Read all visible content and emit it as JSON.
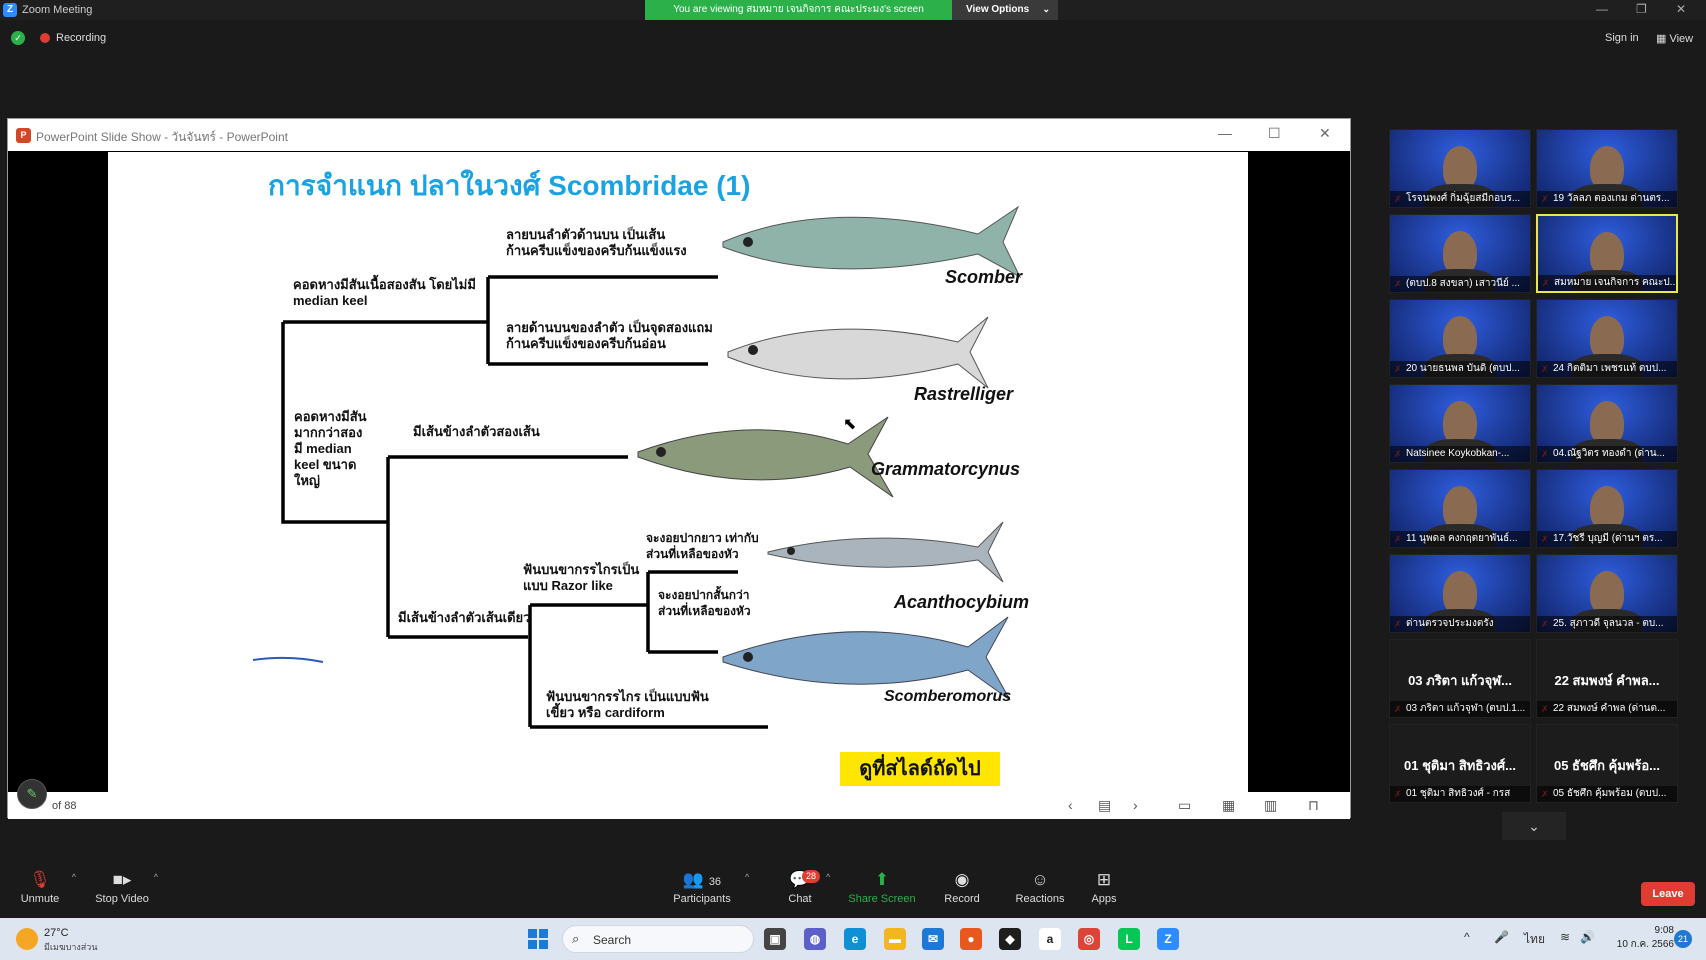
{
  "window": {
    "title": "Zoom Meeting",
    "viewing_banner": "You are viewing สมหมาย เจนกิจการ คณะประมง's screen",
    "view_options": "View Options",
    "recording": "Recording",
    "sign_in": "Sign in",
    "view": "View"
  },
  "powerpoint": {
    "title": "PowerPoint Slide Show - วันจันทร์ - PowerPoint",
    "slide_counter": "of 88"
  },
  "slide": {
    "title": "การจำแนก ปลาในวงศ์ Scombridae (1)",
    "labels": {
      "scomber_desc": "ลายบนลำตัวด้านบน เป็นเส้น\nก้านครีบแข็งของครีบก้นแข็งแรง",
      "rastrelliger_desc": "ลายด้านบนของลำตัว เป็นจุดสองแถม\nก้านครีบแข็งของครีบก้นอ่อน",
      "keel_small": "คอดหางมีสันเนื้อสองสัน โดยไม่มี\nmedian keel",
      "keel_large": "คอดหางมีสัน\nมากกว่าสอง\nมี median\nkeel ขนาด\nใหญ่",
      "two_lateral": "มีเส้นข้างลำตัวสองเส้น",
      "one_lateral": "มีเส้นข้างลำตัวเส้นเดียว",
      "razor_teeth": "ฟันบนขากรรไกรเป็น\nแบบ Razor like",
      "long_beak": "จะงอยปากยาว เท่ากับ\nส่วนที่เหลือของหัว",
      "short_beak": "จะงอยปากสั้นกว่า\nส่วนที่เหลือของหัว",
      "cardiform": "ฟันบนขากรรไกร เป็นแบบฟัน\nเขี้ยว หรือ cardiform"
    },
    "genera": {
      "scomber": "Scomber",
      "rastrelliger": "Rastrelliger",
      "grammatorcynus": "Grammatorcynus",
      "acanthocybium": "Acanthocybium",
      "scomberomorus": "Scomberomorus"
    },
    "next_button": "ดูที่สไลด์ถัดไป"
  },
  "participants": [
    {
      "name": "โรจนพงศ์ กิ่มฉุ้ยสมีกอบร...",
      "video": true
    },
    {
      "name": "19 วัลลภ ตองเกม ด่านตร...",
      "video": true
    },
    {
      "name": "(ตบป.8 สงขลา) เสาวนีย์ ...",
      "video": true
    },
    {
      "name": "สมหมาย เจนกิจการ คณะป...",
      "video": true,
      "active": true
    },
    {
      "name": "20 นายธนพล บันดิ (ตบป...",
      "video": true
    },
    {
      "name": "24 กิตติมา เพชรแท้ ตบป...",
      "video": true
    },
    {
      "name": "Natsinee Koykobkan-...",
      "video": true
    },
    {
      "name": "04.ณัฐวิตร ทองดำ (ด่าน...",
      "video": true
    },
    {
      "name": "11 นุพดล คงกฤตยาพันธ์...",
      "video": true
    },
    {
      "name": "17.วัชรี บุญมี (ด่านฯ ตร...",
      "video": true
    },
    {
      "name": "ด่านตรวจประมงตรัง",
      "video": true
    },
    {
      "name": "25. สุภาวดี จุลนวล - ตบ...",
      "video": true
    },
    {
      "name": "03 ภริตา แก้วจุฬา (ตบป.1...",
      "big": "03 ภริตา แก้วจุฬ...",
      "video": false
    },
    {
      "name": "22 สมพงษ์ คำพล (ด่านต...",
      "big": "22 สมพงษ์ คำพล...",
      "video": false
    },
    {
      "name": "01 ชุติมา สิทธิวงศ์ - กรส",
      "big": "01 ชุติมา สิทธิวงศ์...",
      "video": false
    },
    {
      "name": "05 ธัชศึก คุ้มพร้อม (ตบป...",
      "big": "05 ธัชศึก คุ้มพร้อ...",
      "video": false
    }
  ],
  "toolbar": {
    "unmute": "Unmute",
    "stop_video": "Stop Video",
    "participants": "Participants",
    "participants_count": "36",
    "chat": "Chat",
    "chat_badge": "28",
    "share_screen": "Share Screen",
    "record": "Record",
    "reactions": "Reactions",
    "apps": "Apps",
    "leave": "Leave"
  },
  "taskbar": {
    "temp": "27°C",
    "weather": "มีเมฆบางส่วน",
    "search": "Search",
    "lang": "ไทย",
    "time": "9:08",
    "date": "10 ก.ค. 2566",
    "notif_count": "21"
  }
}
